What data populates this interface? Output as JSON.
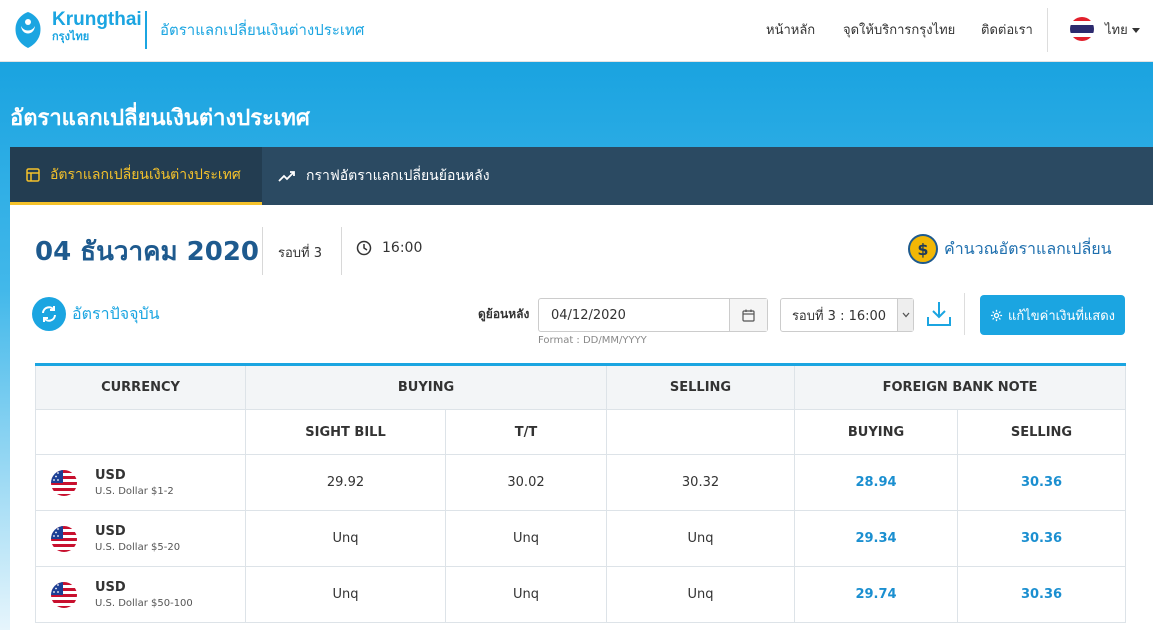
{
  "header": {
    "brand_en": "Krungthai",
    "brand_th": "กรุงไทย",
    "section_title": "อัตราแลกเปลี่ยนเงินต่างประเทศ",
    "nav": [
      "หน้าหลัก",
      "จุดให้บริการกรุงไทย",
      "ติดต่อเรา"
    ],
    "language": "ไทย"
  },
  "hero": {
    "title": "อัตราแลกเปลี่ยนเงินต่างประเทศ"
  },
  "tabs": [
    {
      "label": "อัตราแลกเปลี่ยนเงินต่างประเทศ",
      "active": true
    },
    {
      "label": "กราฟอัตราแลกเปลี่ยนย้อนหลัง",
      "active": false
    }
  ],
  "summary": {
    "date": "04 ธันวาคม 2020",
    "round": "รอบที่ 3",
    "time": "16:00",
    "calc_link": "คำนวณอัตราแลกเปลี่ยน",
    "coin_symbol": "$"
  },
  "controls": {
    "current_rate_link": "อัตราปัจจุบัน",
    "lookback_label": "ดูย้อนหลัง",
    "date_value": "04/12/2020",
    "date_format_hint": "Format : DD/MM/YYYY",
    "round_select": "รอบที่ 3 : 16:00",
    "edit_button": "แก้ไขค่าเงินที่แสดง"
  },
  "table": {
    "headers": {
      "currency": "CURRENCY",
      "buying": "BUYING",
      "selling": "SELLING",
      "foreign_bank_note": "FOREIGN BANK NOTE",
      "sight_bill": "SIGHT BILL",
      "tt": "T/T",
      "fbn_buying": "BUYING",
      "fbn_selling": "SELLING"
    },
    "rows": [
      {
        "code": "USD",
        "name": "U.S. Dollar $1-2",
        "sight_bill": "29.92",
        "tt": "30.02",
        "selling": "30.32",
        "fbn_buying": "28.94",
        "fbn_selling": "30.36"
      },
      {
        "code": "USD",
        "name": "U.S. Dollar $5-20",
        "sight_bill": "Unq",
        "tt": "Unq",
        "selling": "Unq",
        "fbn_buying": "29.34",
        "fbn_selling": "30.36"
      },
      {
        "code": "USD",
        "name": "U.S. Dollar $50-100",
        "sight_bill": "Unq",
        "tt": "Unq",
        "selling": "Unq",
        "fbn_buying": "29.74",
        "fbn_selling": "30.36"
      }
    ]
  },
  "colors": {
    "brand_blue": "#1ba5e1",
    "tab_bar": "#2b4a62",
    "tab_active_accent": "#f5c22b",
    "date_title": "#1e5a8e",
    "fbn_value": "#1b8fd0"
  }
}
